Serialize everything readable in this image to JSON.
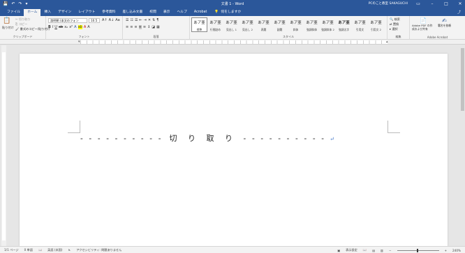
{
  "titlebar": {
    "title": "文書 1 - Word",
    "user": "PCのこと教室 SAKAGUCHI",
    "save_icon": "save-icon",
    "undo_icon": "undo-icon",
    "redo_icon": "redo-icon"
  },
  "tabs": [
    "ファイル",
    "ホーム",
    "挿入",
    "デザイン",
    "レイアウト",
    "参考資料",
    "差し込み文書",
    "校閲",
    "表示",
    "ヘルプ",
    "Acrobat"
  ],
  "active_tab": "ホーム",
  "tell_me": "何をしますか",
  "ribbon": {
    "clipboard": {
      "paste": "貼り付け",
      "cut": "切り取り",
      "copy": "コピー",
      "format_painter": "書式のコピー/貼り付け",
      "label": "クリップボード"
    },
    "font": {
      "name": "游明朝 (本文のフォン",
      "size": "10.5",
      "label": "フォント"
    },
    "paragraph": {
      "label": "段落"
    },
    "styles": {
      "label": "スタイル",
      "items": [
        {
          "sample": "あア亜",
          "name": "標準"
        },
        {
          "sample": "あア亜",
          "name": "行間詰め"
        },
        {
          "sample": "あア亜",
          "name": "見出し 1"
        },
        {
          "sample": "あア亜",
          "name": "見出し 2"
        },
        {
          "sample": "あア亜",
          "name": "表題"
        },
        {
          "sample": "あア亜",
          "name": "副題"
        },
        {
          "sample": "あア亜",
          "name": "斜体"
        },
        {
          "sample": "あア亜",
          "name": "強調斜体"
        },
        {
          "sample": "あア亜",
          "name": "強調斜体 2"
        },
        {
          "sample": "あア亜",
          "name": "強調太字"
        },
        {
          "sample": "あア亜",
          "name": "引用文"
        },
        {
          "sample": "あア亜",
          "name": "引用文 2"
        }
      ]
    },
    "editing": {
      "find": "検索",
      "replace": "置換",
      "select": "選択",
      "label": "編集"
    },
    "acrobat": {
      "create_pdf": "Adobe PDF の作成および共有",
      "sign": "署名を依頼",
      "label": "Adobe Acrobat"
    }
  },
  "document": {
    "left_dashes": "- - - - - - - - - -",
    "text": "切 り 取 り",
    "right_dashes": "- - - - - - - - - -",
    "paragraph_mark": "↵"
  },
  "statusbar": {
    "page": "1/1 ページ",
    "words": "0 単語",
    "language": "英語 (米国)",
    "accessibility": "アクセシビリティ: 問題ありません",
    "display_settings": "表示設定",
    "zoom": "240%"
  },
  "colors": {
    "brand": "#2b579a"
  }
}
